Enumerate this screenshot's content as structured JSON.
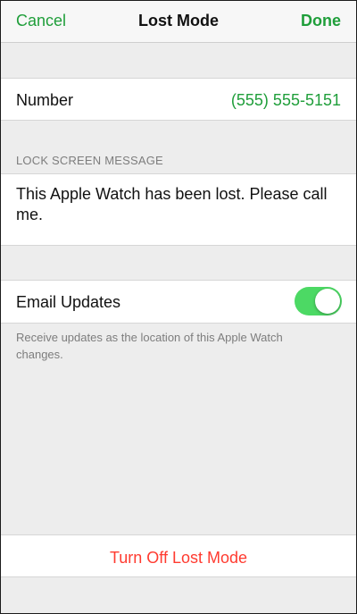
{
  "navbar": {
    "cancel_label": "Cancel",
    "title": "Lost Mode",
    "done_label": "Done"
  },
  "number": {
    "label": "Number",
    "value": "(555) 555-5151"
  },
  "lock_screen": {
    "header": "LOCK SCREEN MESSAGE",
    "message": "This Apple Watch has been lost. Please call me."
  },
  "email_updates": {
    "label": "Email Updates",
    "enabled": true,
    "note": "Receive updates as the location of this Apple Watch changes."
  },
  "turn_off": {
    "label": "Turn Off Lost Mode"
  },
  "colors": {
    "accent_green": "#1f9e3a",
    "toggle_on": "#4cd964",
    "destructive_red": "#ff3b30"
  }
}
